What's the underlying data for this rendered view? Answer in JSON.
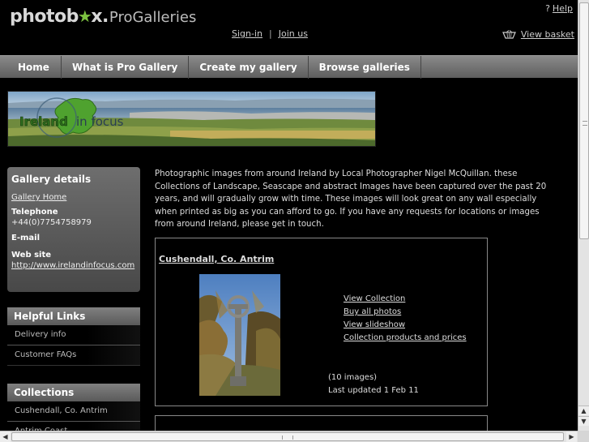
{
  "header": {
    "logo_main": "photob",
    "logo_star": "★",
    "logo_main_end": "x.",
    "logo_sub": "ProGalleries",
    "help_label": "Help",
    "help_icon": "?",
    "sign_in": "Sign-in",
    "separator": "|",
    "join_us": "Join us",
    "view_basket": "View basket",
    "basket_icon": "basket-icon"
  },
  "nav": {
    "items": [
      "Home",
      "What is Pro Gallery",
      "Create my gallery",
      "Browse galleries"
    ]
  },
  "banner": {
    "text_a": "Ireland",
    "text_b": "in focus"
  },
  "gallery_details": {
    "title": "Gallery details",
    "home_link": "Gallery Home",
    "telephone_label": "Telephone",
    "telephone_value": "+44(0)7754758979",
    "email_label": "E-mail",
    "website_label": "Web site",
    "website_value": "http://www.irelandinfocus.com"
  },
  "helpful_links": {
    "title": "Helpful Links",
    "items": [
      "Delivery info",
      "Customer FAQs"
    ]
  },
  "collections_panel": {
    "title": "Collections",
    "items": [
      "Cushendall, Co. Antrim",
      "Antrim Coast"
    ]
  },
  "intro_text": "Photographic images from around Ireland by Local Photographer Nigel McQuillan. these Collections of Landscape, Seascape and abstract Images have been captured over the past 20 years, and will gradually grow with time. These images will look great on any wall especially when printed as big as you can afford to go. If you have any requests for locations or images from around Ireland, please get in touch.",
  "collection": {
    "title": "Cushendall, Co. Antrim",
    "links": [
      "View Collection",
      "Buy all photos",
      "View slideshow",
      "Collection products and prices"
    ],
    "count": "(10 images)",
    "updated": "Last updated 1 Feb 11"
  },
  "colors": {
    "background": "#000000",
    "nav_gradient_top": "#8a8a8a",
    "nav_gradient_bottom": "#5e5e5e",
    "accent_green": "#7cc240"
  }
}
